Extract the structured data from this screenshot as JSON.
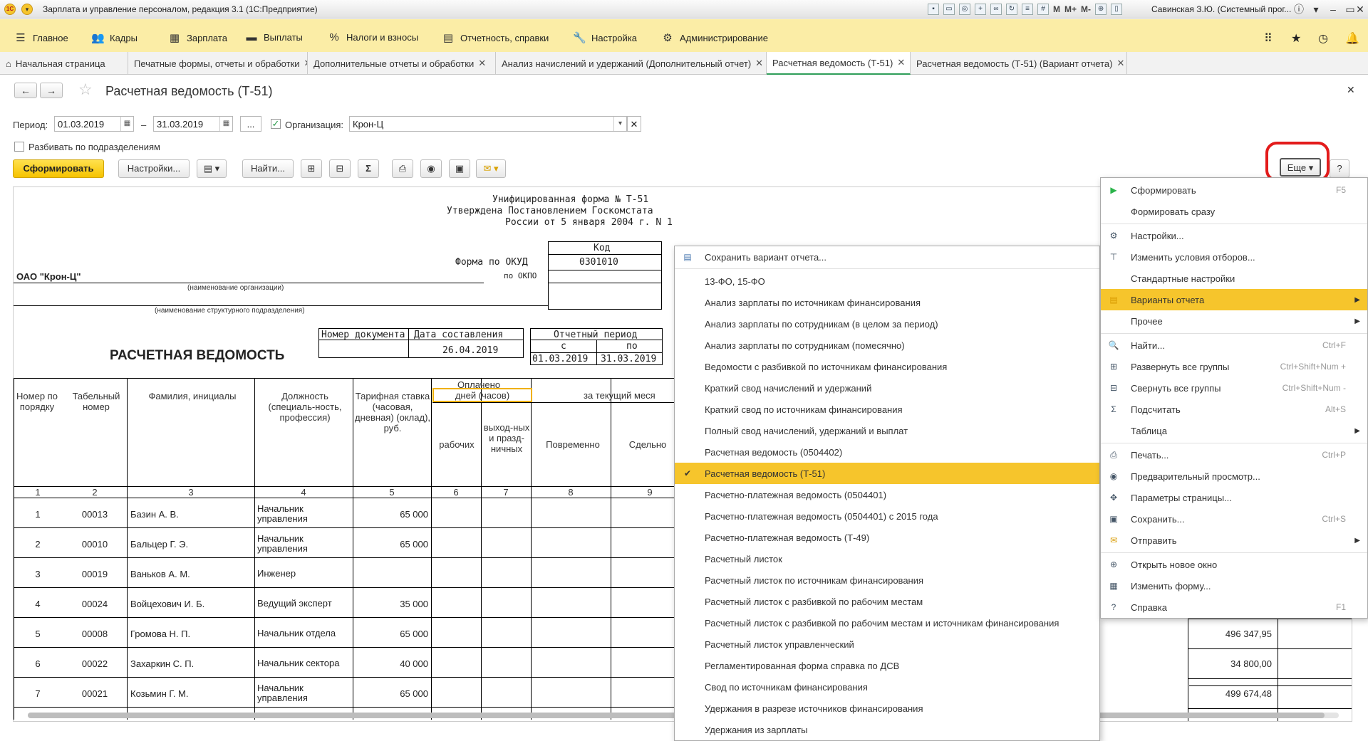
{
  "window": {
    "title": "Зарплата и управление персоналом, редакция 3.1  (1С:Предприятие)",
    "user": "Савинская З.Ю. (Системный прог...",
    "toolbar_text": [
      "M",
      "M+",
      "M-"
    ]
  },
  "mainmenu": [
    {
      "label": "Главное",
      "icon": "menu-icon"
    },
    {
      "label": "Кадры",
      "icon": "people-icon"
    },
    {
      "label": "Зарплата",
      "icon": "calculator-icon"
    },
    {
      "label": "Выплаты",
      "icon": "cash-icon"
    },
    {
      "label": "Налоги и взносы",
      "icon": "percent-icon"
    },
    {
      "label": "Отчетность, справки",
      "icon": "report-icon"
    },
    {
      "label": "Настройка",
      "icon": "wrench-icon"
    },
    {
      "label": "Администрирование",
      "icon": "gear-icon"
    }
  ],
  "tabs": [
    "Начальная страница",
    "Печатные формы, отчеты и обработки",
    "Дополнительные отчеты и обработки",
    "Анализ начислений и удержаний (Дополнительный отчет)",
    "Расчетная ведомость (Т-51)",
    "Расчетная ведомость (Т-51) (Вариант отчета)"
  ],
  "form": {
    "title": "Расчетная ведомость (Т-51)",
    "period_label": "Период:",
    "date_from": "01.03.2019",
    "dash": "–",
    "date_to": "31.03.2019",
    "dots": "...",
    "org_label": "Организация:",
    "org_value": "Крон-Ц",
    "split_label": "Разбивать по подразделениям"
  },
  "toolbar": {
    "generate": "Сформировать",
    "settings": "Настройки...",
    "find": "Найти...",
    "more": "Еще",
    "help": "?"
  },
  "report": {
    "form_no": "Унифицированная форма № Т-51",
    "approved1": "Утверждена Постановлением Госкомстата",
    "approved2": "России от 5 января 2004 г. N 1",
    "kod": "Код",
    "okud_label": "Форма по ОКУД",
    "okud": "0301010",
    "okpo_label": "по ОКПО",
    "org": "ОАО \"Крон-Ц\"",
    "org_caption": "(наименование организации)",
    "dept_caption": "(наименование структурного подразделения)",
    "doc_no_h": "Номер документа",
    "doc_date_h": "Дата составления",
    "doc_date": "26.04.2019",
    "period_h": "Отчетный период",
    "from_h": "с",
    "to_h": "по",
    "from": "01.03.2019",
    "to": "31.03.2019",
    "heading": "РАСЧЕТНАЯ ВЕДОМОСТЬ",
    "cols": {
      "c1": "Номер по порядку",
      "c2": "Табельный номер",
      "c3": "Фамилия, инициалы",
      "c4": "Должность (специаль-ность, профессия)",
      "c5": "Тарифная ставка (часовая, дневная) (оклад), руб.",
      "paid": "Оплачено",
      "days": "дней (часов)",
      "work": "рабочих",
      "off": "выход-ных и празд-ничных",
      "current": "за текущий меся",
      "c8": "Повременно",
      "c9": "Сдельно"
    },
    "colnums": [
      "1",
      "2",
      "3",
      "4",
      "5",
      "6",
      "7",
      "8",
      "9"
    ],
    "rows": [
      {
        "n": "1",
        "tab": "00013",
        "name": "Базин А. В.",
        "pos": "Начальник управления",
        "rate": "65 000",
        "total": ""
      },
      {
        "n": "2",
        "tab": "00010",
        "name": "Бальцер Г. Э.",
        "pos": "Начальник управления",
        "rate": "65 000",
        "total": ""
      },
      {
        "n": "3",
        "tab": "00019",
        "name": "Ваньков А. М.",
        "pos": "Инженер",
        "rate": "",
        "total": ""
      },
      {
        "n": "4",
        "tab": "00024",
        "name": "Войцехович И. Б.",
        "pos": "Ведущий эксперт",
        "rate": "35 000",
        "total": ""
      },
      {
        "n": "5",
        "tab": "00008",
        "name": "Громова Н. П.",
        "pos": "Начальник отдела",
        "rate": "65 000",
        "total": "496 347,95"
      },
      {
        "n": "6",
        "tab": "00022",
        "name": "Захаркин С. П.",
        "pos": "Начальник сектора",
        "rate": "40 000",
        "total": "34 800,00"
      },
      {
        "n": "7",
        "tab": "00021",
        "name": "Козьмин Г. М.",
        "pos": "Начальник управления",
        "rate": "65 000",
        "total": "499 674,48"
      }
    ]
  },
  "variants_menu": {
    "save": "Сохранить вариант отчета...",
    "items": [
      "13-ФО, 15-ФО",
      "Анализ зарплаты по источникам финансирования",
      "Анализ зарплаты по сотрудникам (в целом за период)",
      "Анализ зарплаты по сотрудникам (помесячно)",
      "Ведомости с разбивкой по источникам финансирования",
      "Краткий свод начислений и удержаний",
      "Краткий свод по источникам финансирования",
      "Полный свод начислений, удержаний и выплат",
      "Расчетная ведомость (0504402)",
      "Расчетная ведомость (Т-51)",
      "Расчетно-платежная ведомость (0504401)",
      "Расчетно-платежная ведомость (0504401) с 2015 года",
      "Расчетно-платежная ведомость (Т-49)",
      "Расчетный листок",
      "Расчетный листок по источникам финансирования",
      "Расчетный листок с разбивкой по рабочим местам",
      "Расчетный листок с разбивкой по рабочим местам и источникам финансирования",
      "Расчетный листок управленческий",
      "Регламентированная форма справка по ДСВ",
      "Свод по источникам финансирования",
      "Удержания в разрезе источников финансирования",
      "Удержания из зарплаты"
    ],
    "selected_index": 9
  },
  "more_menu": [
    {
      "label": "Сформировать",
      "shortcut": "F5",
      "icon": "play-icon"
    },
    {
      "label": "Формировать сразу",
      "shortcut": "",
      "icon": ""
    },
    {
      "label": "Настройки...",
      "shortcut": "",
      "icon": "settings-icon"
    },
    {
      "label": "Изменить условия отборов...",
      "shortcut": "",
      "icon": "filter-icon"
    },
    {
      "label": "Стандартные настройки",
      "shortcut": "",
      "icon": ""
    },
    {
      "label": "Варианты отчета",
      "shortcut": "",
      "icon": "variants-icon",
      "submenu": true
    },
    {
      "label": "Прочее",
      "shortcut": "",
      "icon": "",
      "submenu": true
    },
    {
      "label": "Найти...",
      "shortcut": "Ctrl+F",
      "icon": "search-icon"
    },
    {
      "label": "Развернуть все группы",
      "shortcut": "Ctrl+Shift+Num +",
      "icon": "expand-icon"
    },
    {
      "label": "Свернуть все группы",
      "shortcut": "Ctrl+Shift+Num -",
      "icon": "collapse-icon"
    },
    {
      "label": "Подсчитать",
      "shortcut": "Alt+S",
      "icon": "sum-icon"
    },
    {
      "label": "Таблица",
      "shortcut": "",
      "icon": "",
      "submenu": true
    },
    {
      "label": "Печать...",
      "shortcut": "Ctrl+P",
      "icon": "print-icon"
    },
    {
      "label": "Предварительный просмотр...",
      "shortcut": "",
      "icon": "preview-icon"
    },
    {
      "label": "Параметры страницы...",
      "shortcut": "",
      "icon": "page-setup-icon"
    },
    {
      "label": "Сохранить...",
      "shortcut": "Ctrl+S",
      "icon": "save-icon"
    },
    {
      "label": "Отправить",
      "shortcut": "",
      "icon": "mail-icon",
      "submenu": true
    },
    {
      "label": "Открыть новое окно",
      "shortcut": "",
      "icon": "new-window-icon"
    },
    {
      "label": "Изменить форму...",
      "shortcut": "",
      "icon": "form-icon"
    },
    {
      "label": "Справка",
      "shortcut": "F1",
      "icon": "help-icon"
    }
  ]
}
